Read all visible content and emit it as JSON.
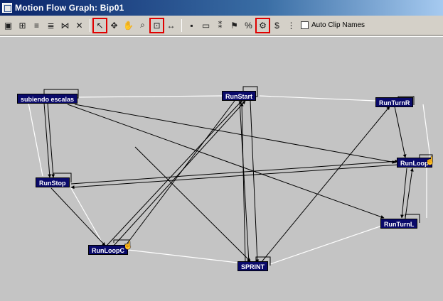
{
  "window": {
    "title": "Motion Flow Graph: Bip01"
  },
  "toolbar": {
    "buttons": [
      {
        "icon": "create-clip-icon",
        "glyph": "▣"
      },
      {
        "icon": "open-clip-icon",
        "glyph": "⊞"
      },
      {
        "icon": "save-flow-icon",
        "glyph": "≡"
      },
      {
        "icon": "load-flow-icon",
        "glyph": "≣"
      },
      {
        "icon": "show-all-icon",
        "glyph": "⋈"
      },
      {
        "icon": "delete-icon",
        "glyph": "✕"
      },
      {
        "icon": "select-arrow-icon",
        "glyph": "↖",
        "highlighted": true
      },
      {
        "icon": "move-icon",
        "glyph": "✥"
      },
      {
        "icon": "pan-hand-icon",
        "glyph": "✋"
      },
      {
        "icon": "zoom-icon",
        "glyph": "⌕"
      },
      {
        "icon": "zoom-region-icon",
        "glyph": "⊡",
        "highlighted": true
      },
      {
        "icon": "zoom-extents-icon",
        "glyph": "↔"
      },
      {
        "icon": "create-transition-icon",
        "glyph": "▪"
      },
      {
        "icon": "rest-icon",
        "glyph": "▭"
      },
      {
        "icon": "optimize-icon",
        "glyph": "⁑"
      },
      {
        "icon": "flag-icon",
        "glyph": "⚑"
      },
      {
        "icon": "percent-icon",
        "glyph": "%"
      },
      {
        "icon": "random-icon",
        "glyph": "⚙",
        "highlighted": true
      },
      {
        "icon": "dollar-icon",
        "glyph": "$"
      },
      {
        "icon": "properties-icon",
        "glyph": "⋮"
      }
    ],
    "auto_clip_label": "Auto Clip Names",
    "auto_clip_checked": false
  },
  "graph": {
    "node_color": "#0a0a6a",
    "nodes": [
      {
        "id": "subiendo",
        "label": "subiendo escalas"
      },
      {
        "id": "runstart",
        "label": "RunStart"
      },
      {
        "id": "runturnr",
        "label": "RunTurnR"
      },
      {
        "id": "runloop",
        "label": "RunLoop"
      },
      {
        "id": "runstop",
        "label": "RunStop"
      },
      {
        "id": "runturnl",
        "label": "RunTurnL"
      },
      {
        "id": "runloopc",
        "label": "RunLoopC"
      },
      {
        "id": "sprint",
        "label": "SPRINT"
      }
    ]
  }
}
